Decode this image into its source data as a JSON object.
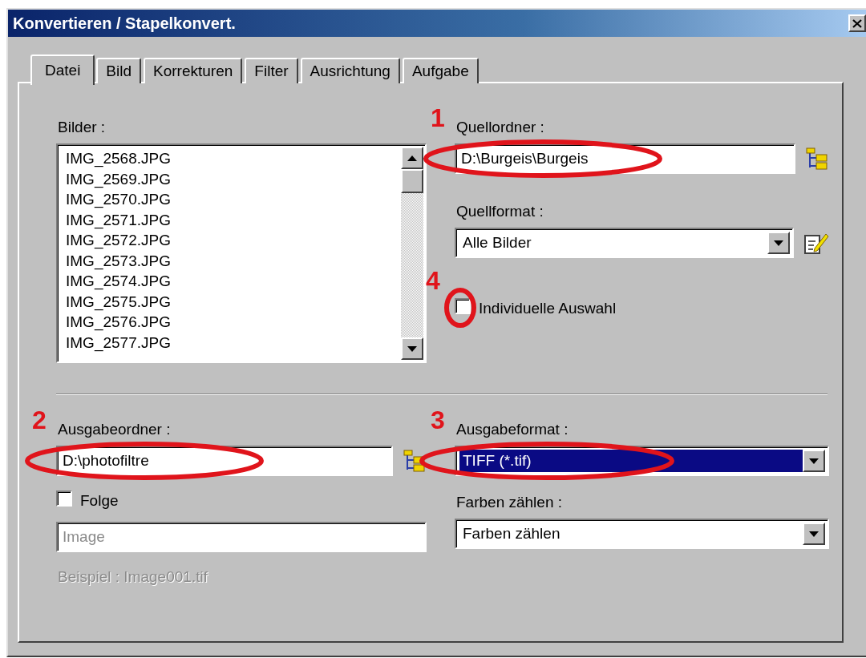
{
  "window": {
    "title": "Konvertieren / Stapelkonvert."
  },
  "tabs": [
    {
      "label": "Datei",
      "selected": true
    },
    {
      "label": "Bild",
      "selected": false
    },
    {
      "label": "Korrekturen",
      "selected": false
    },
    {
      "label": "Filter",
      "selected": false
    },
    {
      "label": "Ausrichtung",
      "selected": false
    },
    {
      "label": "Aufgabe",
      "selected": false
    }
  ],
  "images": {
    "label": "Bilder :",
    "items": [
      {
        "name": "IMG_2568.JPG",
        "selected": false
      },
      {
        "name": "IMG_2569.JPG",
        "selected": false
      },
      {
        "name": "IMG_2570.JPG",
        "selected": false
      },
      {
        "name": "IMG_2571.JPG",
        "selected": false
      },
      {
        "name": "IMG_2572.JPG",
        "selected": false
      },
      {
        "name": "IMG_2573.JPG",
        "selected": false
      },
      {
        "name": "IMG_2574.JPG",
        "selected": false
      },
      {
        "name": "IMG_2575.JPG",
        "selected": false
      },
      {
        "name": "IMG_2576.JPG",
        "selected": false
      },
      {
        "name": "IMG_2577.JPG",
        "selected": false
      }
    ]
  },
  "source_folder": {
    "label": "Quellordner :",
    "value": "D:\\Burgeis\\Burgeis",
    "annotation": "1"
  },
  "source_format": {
    "label": "Quellformat :",
    "value": "Alle Bilder"
  },
  "individual_selection": {
    "label": "Individuelle Auswahl",
    "checked": false,
    "annotation": "4"
  },
  "output_folder": {
    "label": "Ausgabeordner :",
    "value": "D:\\photofiltre",
    "annotation": "2"
  },
  "sequence": {
    "label": "Folge",
    "checked": false
  },
  "sequence_name": {
    "value": "Image",
    "disabled": true
  },
  "example": {
    "text": "Beispiel : Image001.tif",
    "disabled": true
  },
  "output_format": {
    "label": "Ausgabeformat :",
    "value": "TIFF (*.tif)",
    "highlighted": true,
    "annotation": "3"
  },
  "color_count": {
    "label": "Farben zählen :",
    "value": "Farben zählen"
  }
}
